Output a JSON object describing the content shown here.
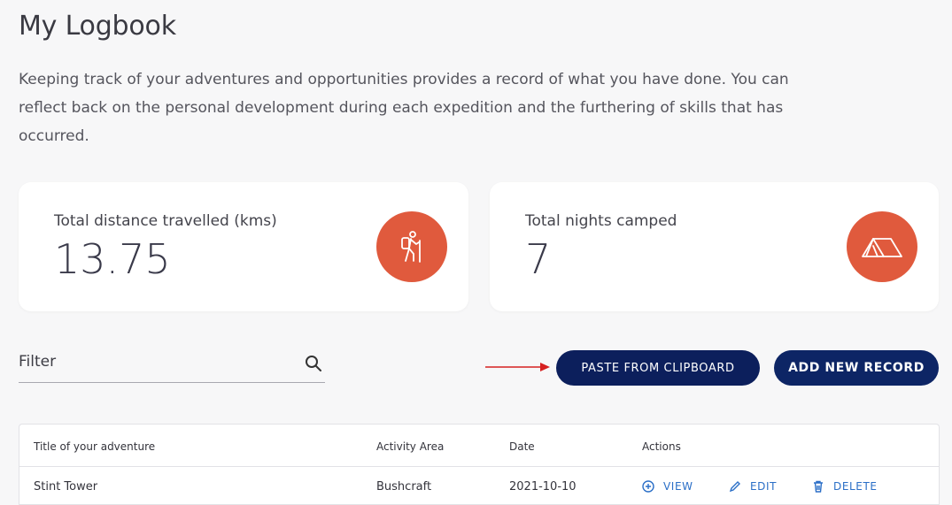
{
  "page": {
    "title": "My Logbook",
    "intro": "Keeping track of your adventures and opportunities provides a record of what you have done. You can reflect back on the personal development during each expedition and the furthering of skills that has occurred."
  },
  "stats": {
    "distance_label": "Total distance travelled (kms)",
    "distance_value": "13.75",
    "distance_icon": "hiker-icon",
    "nights_label": "Total nights camped",
    "nights_value": "7",
    "nights_icon": "tent-icon",
    "icon_color": "#e05a3d"
  },
  "filter": {
    "placeholder": "Filter",
    "icon": "search-icon"
  },
  "toolbar": {
    "paste_label": "PASTE FROM CLIPBOARD",
    "add_label": "ADD NEW RECORD",
    "button_color": "#0c1f5c"
  },
  "table": {
    "columns": [
      "Title of your adventure",
      "Activity Area",
      "Date",
      "Actions"
    ],
    "rows": [
      {
        "title": "Stint Tower",
        "area": "Bushcraft",
        "date": "2021-10-10",
        "actions": [
          "VIEW",
          "EDIT",
          "DELETE"
        ]
      }
    ],
    "action_color": "#2b6fc7"
  }
}
